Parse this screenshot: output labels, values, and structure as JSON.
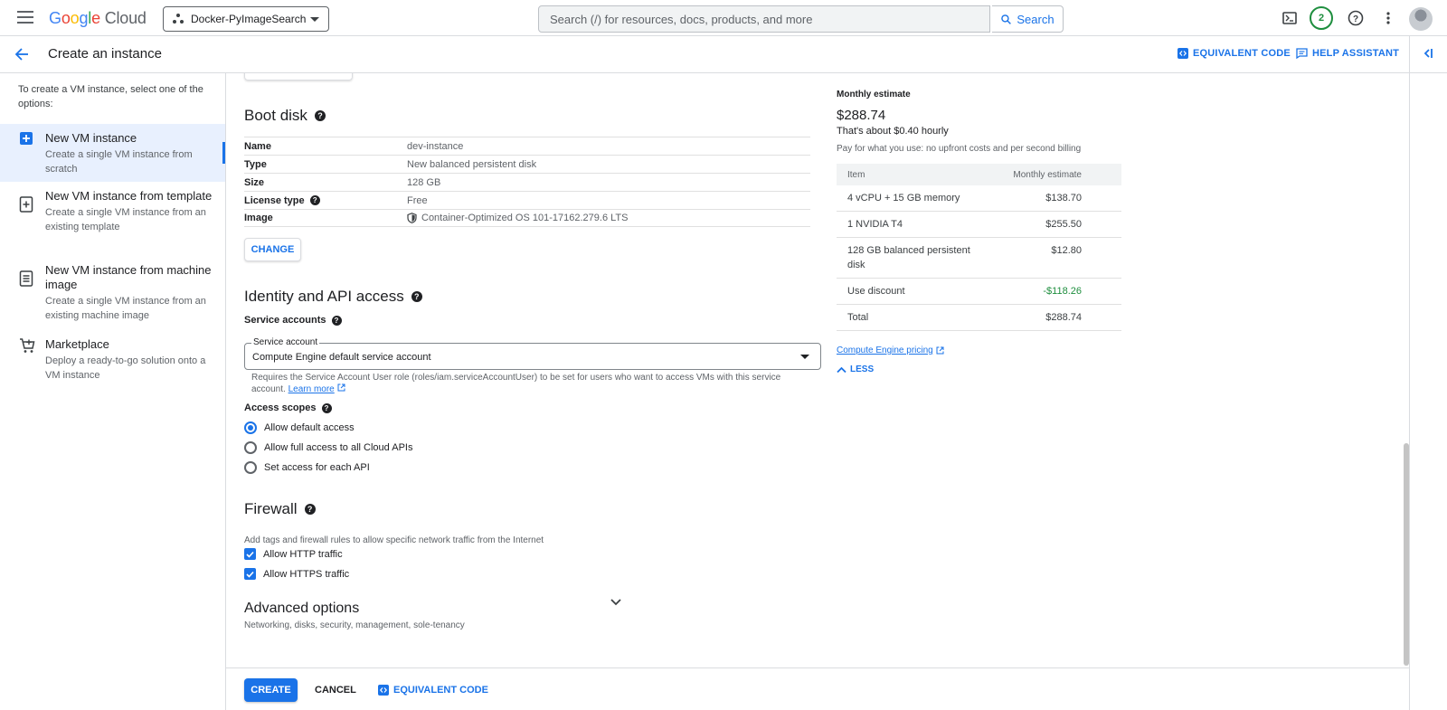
{
  "header": {
    "logo_google": "Google",
    "logo_cloud": "Cloud",
    "project": "Docker-PyImageSearch",
    "search_placeholder": "Search (/) for resources, docs, products, and more",
    "search_button": "Search",
    "notification_count": "2"
  },
  "subheader": {
    "title": "Create an instance",
    "equivalent_code": "EQUIVALENT CODE",
    "help_assistant": "HELP ASSISTANT"
  },
  "sidebar": {
    "intro": "To create a VM instance, select one of the options:",
    "items": [
      {
        "title": "New VM instance",
        "desc": "Create a single VM instance from scratch"
      },
      {
        "title": "New VM instance from template",
        "desc": "Create a single VM instance from an existing template"
      },
      {
        "title": "New VM instance from machine image",
        "desc": "Create a single VM instance from an existing machine image"
      },
      {
        "title": "Marketplace",
        "desc": "Deploy a ready-to-go solution onto a VM instance"
      }
    ]
  },
  "boot_disk": {
    "title": "Boot disk",
    "rows": [
      {
        "key": "Name",
        "value": "dev-instance"
      },
      {
        "key": "Type",
        "value": "New balanced persistent disk"
      },
      {
        "key": "Size",
        "value": "128 GB"
      },
      {
        "key": "License type",
        "value": "Free"
      },
      {
        "key": "Image",
        "value": "Container-Optimized OS 101-17162.279.6 LTS"
      }
    ],
    "change_button": "CHANGE"
  },
  "identity": {
    "title": "Identity and API access",
    "service_accounts_label": "Service accounts",
    "service_account_float": "Service account",
    "service_account_value": "Compute Engine default service account",
    "helper_text": "Requires the Service Account User role (roles/iam.serviceAccountUser) to be set for users who want to access VMs with this service account.",
    "learn_more": "Learn more",
    "access_scopes_label": "Access scopes",
    "scopes": [
      "Allow default access",
      "Allow full access to all Cloud APIs",
      "Set access for each API"
    ]
  },
  "firewall": {
    "title": "Firewall",
    "desc": "Add tags and firewall rules to allow specific network traffic from the Internet",
    "options": [
      "Allow HTTP traffic",
      "Allow HTTPS traffic"
    ]
  },
  "advanced": {
    "title": "Advanced options",
    "desc": "Networking, disks, security, management, sole-tenancy"
  },
  "estimate": {
    "label": "Monthly estimate",
    "price": "$288.74",
    "hourly": "That's about $0.40 hourly",
    "note": "Pay for what you use: no upfront costs and per second billing",
    "col_item": "Item",
    "col_estimate": "Monthly estimate",
    "rows": [
      {
        "item": "4 vCPU + 15 GB memory",
        "cost": "$138.70"
      },
      {
        "item": "1 NVIDIA T4",
        "cost": "$255.50"
      },
      {
        "item": "128 GB balanced persistent disk",
        "cost": "$12.80"
      },
      {
        "item": "Use discount",
        "cost": "-$118.26"
      },
      {
        "item": "Total",
        "cost": "$288.74"
      }
    ],
    "pricing_link": "Compute Engine pricing",
    "less": "LESS"
  },
  "footer": {
    "create": "CREATE",
    "cancel": "CANCEL",
    "equivalent_code": "EQUIVALENT CODE"
  },
  "colors": {
    "accent": "#1a73e8",
    "success": "#1e8e3e",
    "text": "#202124",
    "muted": "#5f6368"
  }
}
